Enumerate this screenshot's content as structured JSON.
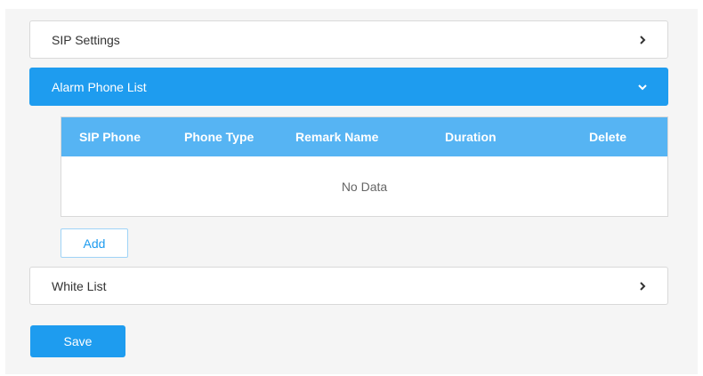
{
  "sections": {
    "sip_settings": {
      "label": "SIP Settings",
      "icon": "chevron-right-icon"
    },
    "alarm_phone_list": {
      "label": "Alarm Phone List",
      "icon": "chevron-down-icon"
    },
    "white_list": {
      "label": "White List",
      "icon": "chevron-right-icon"
    }
  },
  "table": {
    "columns": [
      "SIP Phone",
      "Phone Type",
      "Remark Name",
      "Duration",
      "Delete"
    ],
    "empty_text": "No Data"
  },
  "buttons": {
    "add_label": "Add",
    "save_label": "Save"
  },
  "colors": {
    "accent": "#1e9cef",
    "table_header": "#56b4f3",
    "panel_bg": "#f5f5f5"
  }
}
